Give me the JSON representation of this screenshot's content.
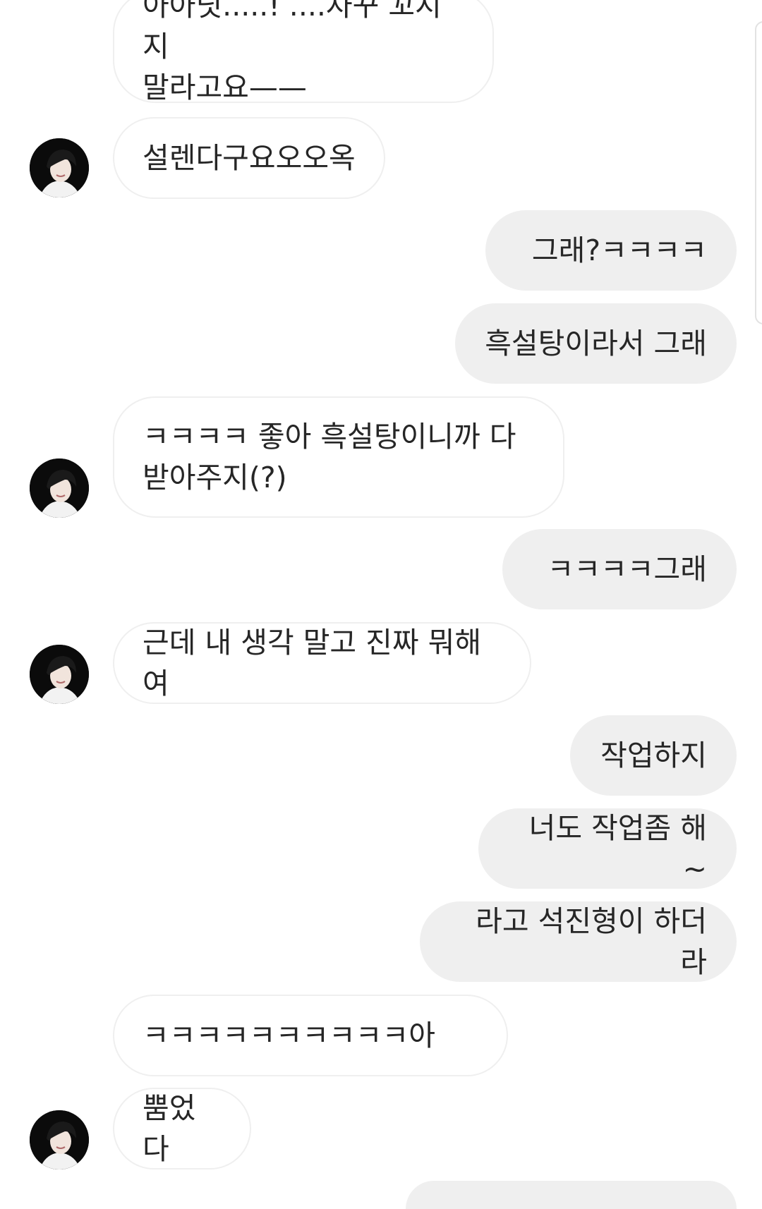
{
  "thread": {
    "messages": [
      {
        "id": "m1",
        "sender": "them",
        "text": "아아닛.....! ....자꾸 꼬시지\n말라고요——"
      },
      {
        "id": "m2",
        "sender": "them",
        "text": "설렌다구요오오옥"
      },
      {
        "id": "m3",
        "sender": "me",
        "text": "그래?ㅋㅋㅋㅋ"
      },
      {
        "id": "m4",
        "sender": "me",
        "text": "흑설탕이라서 그래"
      },
      {
        "id": "m5",
        "sender": "them",
        "text": "ㅋㅋㅋㅋ 좋아 흑설탕이니까 다\n받아주지(?)"
      },
      {
        "id": "m6",
        "sender": "me",
        "text": "ㅋㅋㅋㅋ그래"
      },
      {
        "id": "m7",
        "sender": "them",
        "text": "근데 내 생각 말고 진짜 뭐해여"
      },
      {
        "id": "m8",
        "sender": "me",
        "text": "작업하지"
      },
      {
        "id": "m9",
        "sender": "me",
        "text": "너도 작업좀 해~"
      },
      {
        "id": "m10",
        "sender": "me",
        "text": "라고 석진형이 하더라"
      },
      {
        "id": "m11",
        "sender": "them",
        "text": "ㅋㅋㅋㅋㅋㅋㅋㅋㅋㅋ아"
      },
      {
        "id": "m12",
        "sender": "them",
        "text": "뿜었다"
      }
    ]
  },
  "colors": {
    "incoming_bubble_bg": "#ffffff",
    "incoming_bubble_border": "#efefef",
    "outgoing_bubble_bg": "#efefef",
    "text": "#262626",
    "avatar_bg": "#0b0b0b"
  },
  "icons": {
    "avatar": "profile-photo"
  }
}
